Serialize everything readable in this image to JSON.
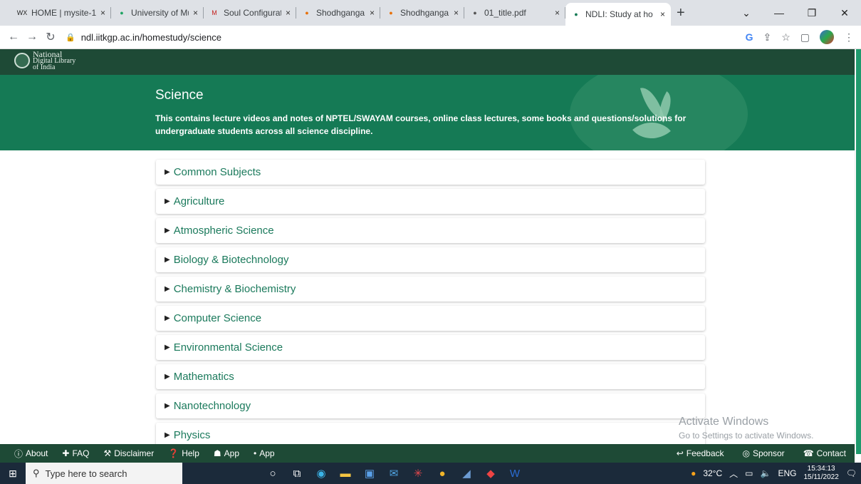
{
  "browser": {
    "tabs": [
      {
        "title": "HOME | mysite-1",
        "favicon": "WX"
      },
      {
        "title": "University of Mur",
        "favicon": "drive"
      },
      {
        "title": "Soul Configuratio",
        "favicon": "M"
      },
      {
        "title": "Shodhganga@IN",
        "favicon": "sg"
      },
      {
        "title": "Shodhganga@IN",
        "favicon": "sg"
      },
      {
        "title": "01_title.pdf",
        "favicon": "pdf"
      },
      {
        "title": "NDLI: Study at ho",
        "favicon": "ndli"
      }
    ],
    "close_glyph": "×",
    "new_tab": "+",
    "url": "ndl.iitkgp.ac.in/homestudy/science"
  },
  "site": {
    "logo": {
      "line1": "National",
      "line2": "Digital Library",
      "line3": "of India"
    },
    "hero": {
      "title": "Science",
      "description": "This contains lecture videos and notes of NPTEL/SWAYAM courses, online class lectures, some books and questions/solutions for undergraduate students across all science discipline."
    },
    "subjects": [
      "Common Subjects",
      "Agriculture",
      "Atmospheric Science",
      "Biology & Biotechnology",
      "Chemistry & Biochemistry",
      "Computer Science",
      "Environmental Science",
      "Mathematics",
      "Nanotechnology",
      "Physics"
    ],
    "footer": {
      "left": [
        {
          "label": "About",
          "icon": "info-icon"
        },
        {
          "label": "FAQ",
          "icon": "faq-icon"
        },
        {
          "label": "Disclaimer",
          "icon": "gavel-icon"
        },
        {
          "label": "Help",
          "icon": "help-icon"
        },
        {
          "label": "App",
          "icon": "android-icon"
        },
        {
          "label": "App",
          "icon": "apple-icon"
        }
      ],
      "right": [
        {
          "label": "Feedback",
          "icon": "feedback-icon"
        },
        {
          "label": "Sponsor",
          "icon": "sponsor-icon"
        },
        {
          "label": "Contact",
          "icon": "phone-icon"
        }
      ]
    }
  },
  "watermark": {
    "line1": "Activate Windows",
    "line2": "Go to Settings to activate Windows."
  },
  "taskbar": {
    "search_placeholder": "Type here to search",
    "temperature": "32°C",
    "language": "ENG",
    "time": "15:34:13",
    "date": "15/11/2022"
  },
  "colors": {
    "header_dark": "#1e4a36",
    "hero_green": "#157a55",
    "link_green": "#1b7a5c"
  }
}
